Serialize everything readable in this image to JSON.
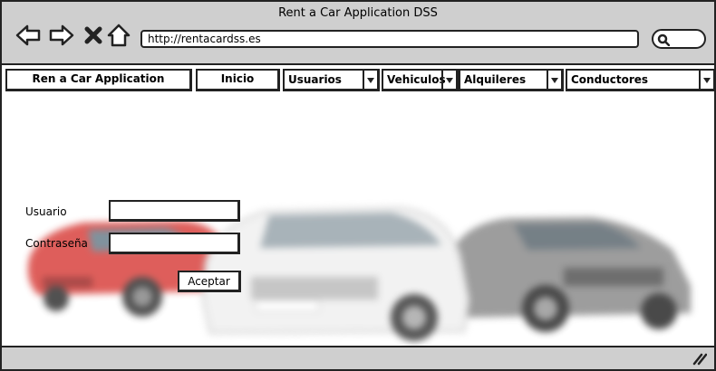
{
  "window": {
    "title": "Rent a Car Application DSS"
  },
  "browser": {
    "url": "http://rentacardss.es",
    "icons": [
      "arrow-left-icon",
      "arrow-right-icon",
      "close-icon",
      "home-icon",
      "search-icon"
    ]
  },
  "menu": {
    "app_label": "Ren a Car Application",
    "inicio": "Inicio",
    "usuarios": "Usuarios",
    "vehiculos": "Vehiculos",
    "alquileres": "Alquileres",
    "conductores": "Conductores"
  },
  "login": {
    "user_label": "Usuario",
    "password_label": "Contraseña",
    "user_value": "",
    "password_value": "",
    "accept_label": "Aceptar"
  },
  "colors": {
    "chrome": "#cfcfcf",
    "border": "#222222",
    "car_red": "#d9433f",
    "car_white": "#f2f2f2",
    "car_gray": "#8c8c8c"
  }
}
